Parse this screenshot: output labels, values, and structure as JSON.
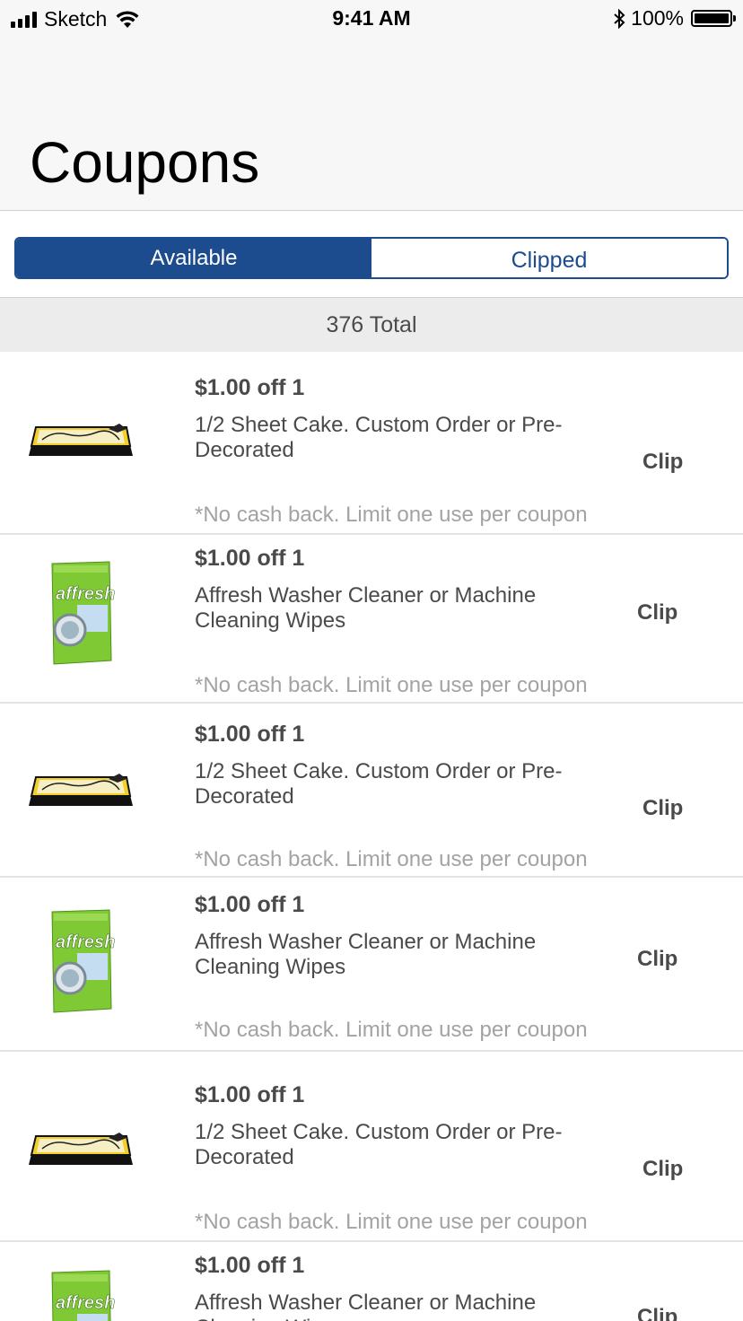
{
  "status_bar": {
    "carrier": "Sketch",
    "time": "9:41 AM",
    "battery_percent": "100%"
  },
  "page_title": "Coupons",
  "segments": {
    "available_label": "Available",
    "clipped_label": "Clipped",
    "selected": "Available"
  },
  "colors": {
    "accent": "#1c4b8e",
    "total_bar": "#ececec",
    "terms_text": "#a3a3a3"
  },
  "total_label": "376 Total",
  "coupons": [
    {
      "image": "sheet-cake-image",
      "offer": "$1.00 off 1",
      "description": "1/2 Sheet Cake. Custom Order or Pre-Decorated",
      "terms": "*No cash back. Limit one use per coupon",
      "action": "Clip"
    },
    {
      "image": "affresh-pouch-image",
      "offer": "$1.00 off 1",
      "description": "Affresh Washer Cleaner or Machine Cleaning Wipes",
      "terms": "*No cash back. Limit one use per coupon",
      "action": "Clip"
    },
    {
      "image": "sheet-cake-image",
      "offer": "$1.00 off 1",
      "description": "1/2 Sheet Cake. Custom Order or Pre-Decorated",
      "terms": "*No cash back. Limit one use per coupon",
      "action": "Clip"
    },
    {
      "image": "affresh-pouch-image",
      "offer": "$1.00 off 1",
      "description": "Affresh Washer Cleaner or Machine Cleaning Wipes",
      "terms": "*No cash back. Limit one use per coupon",
      "action": "Clip"
    },
    {
      "image": "sheet-cake-image",
      "offer": "$1.00 off 1",
      "description": "1/2 Sheet Cake. Custom Order or Pre-Decorated",
      "terms": "*No cash back. Limit one use per coupon",
      "action": "Clip"
    },
    {
      "image": "affresh-pouch-image",
      "offer": "$1.00 off 1",
      "description": "Affresh Washer Cleaner or Machine Cleaning Wipes",
      "terms": "",
      "action": "Clip"
    }
  ]
}
